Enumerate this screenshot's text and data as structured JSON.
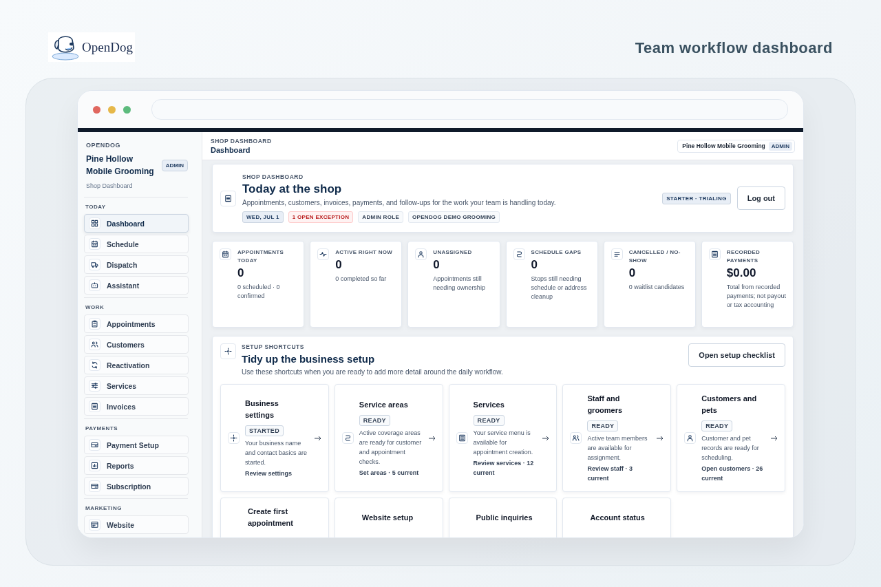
{
  "logo": {
    "text": "OpenDog"
  },
  "page_title": "Team workflow dashboard",
  "sidebar": {
    "org_label": "OPENDOG",
    "shop_name": "Pine Hollow Mobile Grooming",
    "role_badge": "ADMIN",
    "subtitle": "Shop Dashboard",
    "sections": [
      {
        "label": "TODAY",
        "items": [
          {
            "label": "Dashboard",
            "selected": true
          },
          {
            "label": "Schedule",
            "selected": false
          },
          {
            "label": "Dispatch",
            "selected": false
          },
          {
            "label": "Assistant",
            "selected": false
          }
        ]
      },
      {
        "label": "WORK",
        "items": [
          {
            "label": "Appointments",
            "selected": false
          },
          {
            "label": "Customers",
            "selected": false
          },
          {
            "label": "Reactivation",
            "selected": false
          },
          {
            "label": "Services",
            "selected": false
          },
          {
            "label": "Invoices",
            "selected": false
          }
        ]
      },
      {
        "label": "PAYMENTS",
        "items": [
          {
            "label": "Payment Setup",
            "selected": false
          },
          {
            "label": "Reports",
            "selected": false
          },
          {
            "label": "Subscription",
            "selected": false
          }
        ]
      },
      {
        "label": "MARKETING",
        "items": [
          {
            "label": "Website",
            "selected": false
          }
        ]
      }
    ]
  },
  "topbar": {
    "section": "SHOP DASHBOARD",
    "title": "Dashboard",
    "shop": "Pine Hollow Mobile Grooming",
    "role": "ADMIN"
  },
  "hero": {
    "eyebrow": "SHOP DASHBOARD",
    "title": "Today at the shop",
    "description": "Appointments, customers, invoices, payments, and follow-ups for the work your team is handling today.",
    "tags": [
      {
        "text": "WED, JUL 1",
        "kind": "date"
      },
      {
        "text": "1 OPEN EXCEPTION",
        "kind": "alert"
      },
      {
        "text": "ADMIN ROLE",
        "kind": "plain"
      },
      {
        "text": "OPENDOG DEMO GROOMING",
        "kind": "plain"
      }
    ],
    "plan_badge": "STARTER · TRIALING",
    "logout_button": "Log out"
  },
  "stats": [
    {
      "label": "APPOINTMENTS TODAY",
      "value": "0",
      "note": "0 scheduled · 0 confirmed"
    },
    {
      "label": "ACTIVE RIGHT NOW",
      "value": "0",
      "note": "0 completed so far"
    },
    {
      "label": "UNASSIGNED",
      "value": "0",
      "note": "Appointments still needing ownership"
    },
    {
      "label": "SCHEDULE GAPS",
      "value": "0",
      "note": "Stops still needing schedule or address cleanup"
    },
    {
      "label": "CANCELLED / NO-SHOW",
      "value": "0",
      "note": "0 waitlist candidates"
    },
    {
      "label": "RECORDED PAYMENTS",
      "value": "$0.00",
      "note": "Total from recorded payments; not payout or tax accounting"
    }
  ],
  "setup": {
    "eyebrow": "SETUP SHORTCUTS",
    "title": "Tidy up the business setup",
    "description": "Use these shortcuts when you are ready to add more detail around the daily workflow.",
    "button": "Open setup checklist",
    "cards": [
      {
        "title": "Business settings",
        "status": "STARTED",
        "description": "Your business name and contact basics are started.",
        "link": "Review settings"
      },
      {
        "title": "Service areas",
        "status": "READY",
        "description": "Active coverage areas are ready for customer and appointment checks.",
        "link": "Set areas · 5 current"
      },
      {
        "title": "Services",
        "status": "READY",
        "description": "Your service menu is available for appointment creation.",
        "link": "Review services · 12 current"
      },
      {
        "title": "Staff and groomers",
        "status": "READY",
        "description": "Active team members are available for assignment.",
        "link": "Review staff · 3 current"
      },
      {
        "title": "Customers and pets",
        "status": "READY",
        "description": "Customer and pet records are ready for scheduling.",
        "link": "Open customers · 26 current"
      },
      {
        "title": "Create first appointment"
      },
      {
        "title": "Website setup"
      },
      {
        "title": "Public inquiries"
      },
      {
        "title": "Account status"
      }
    ]
  }
}
